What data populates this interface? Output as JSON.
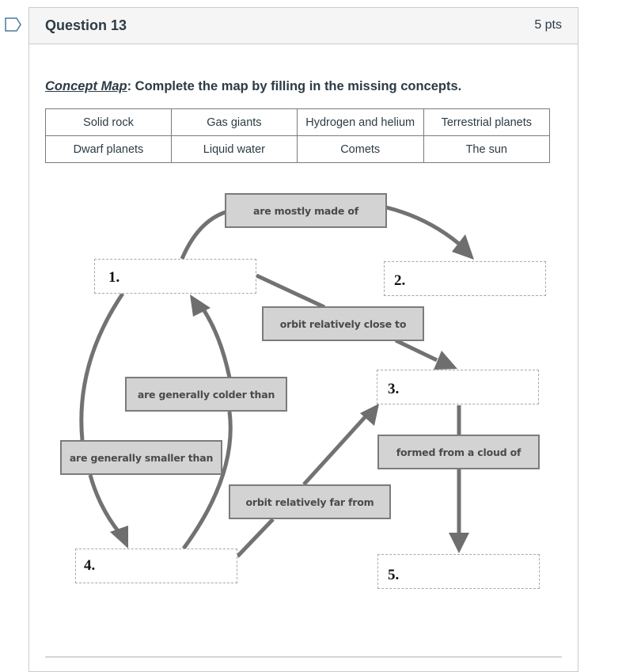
{
  "question": {
    "title": "Question 13",
    "points": "5 pts",
    "flag_icon": "bookmark-flag-icon",
    "instruction_em": "Concept Map",
    "instruction_rest": ": Complete the map by filling in the missing concepts."
  },
  "word_bank": {
    "rows": [
      [
        "Solid rock",
        "Gas giants",
        "Hydrogen and helium",
        "Terrestrial planets"
      ],
      [
        "Dwarf planets",
        "Liquid water",
        "Comets",
        "The sun"
      ]
    ]
  },
  "concept_map": {
    "slots": [
      {
        "label": "1."
      },
      {
        "label": "2."
      },
      {
        "label": "3."
      },
      {
        "label": "4."
      },
      {
        "label": "5."
      }
    ],
    "links": [
      {
        "text": "are mostly made of",
        "from": "1.",
        "to": "2."
      },
      {
        "text": "orbit relatively close to",
        "from": "1.",
        "to": "3."
      },
      {
        "text": "are generally colder than",
        "from": "4.",
        "to": "1."
      },
      {
        "text": "are generally smaller than",
        "from": "1.",
        "to": "4."
      },
      {
        "text": "orbit relatively far from",
        "from": "4.",
        "to": "3."
      },
      {
        "text": "formed from a cloud of",
        "from": "3.",
        "to": "5."
      }
    ]
  }
}
